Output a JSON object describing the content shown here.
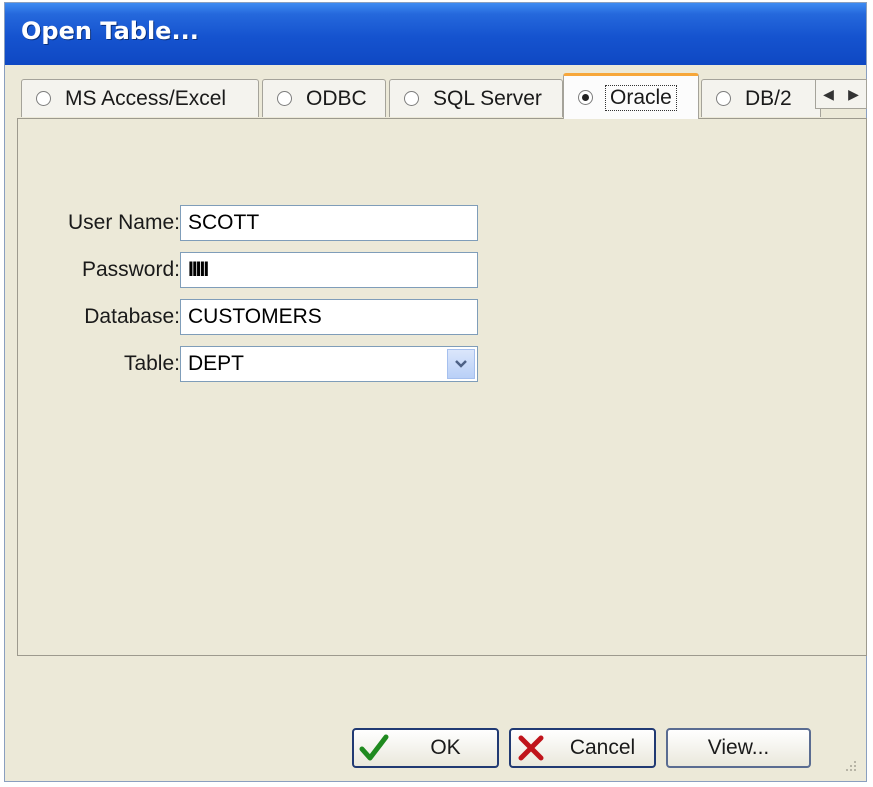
{
  "window": {
    "title": "Open Table..."
  },
  "tabs": [
    {
      "label": "MS Access/Excel",
      "selected": false
    },
    {
      "label": "ODBC",
      "selected": false
    },
    {
      "label": "SQL Server",
      "selected": false
    },
    {
      "label": "Oracle",
      "selected": true
    },
    {
      "label": "DB/2",
      "selected": false
    }
  ],
  "form": {
    "user_name": {
      "label": "User Name:",
      "value": "SCOTT"
    },
    "password": {
      "label": "Password:",
      "value": "IIIII"
    },
    "database": {
      "label": "Database:",
      "value": "CUSTOMERS"
    },
    "table": {
      "label": "Table:",
      "value": "DEPT"
    }
  },
  "buttons": {
    "ok": "OK",
    "cancel": "Cancel",
    "view": "View..."
  },
  "colors": {
    "title_bar": "#1553cf",
    "dialog_bg": "#ece9d8",
    "active_tab_accent": "#f7a73a"
  },
  "icons": [
    "checkmark-icon",
    "x-icon",
    "chevron-down-icon",
    "arrow-left-icon",
    "arrow-right-icon",
    "resize-grip-icon"
  ]
}
